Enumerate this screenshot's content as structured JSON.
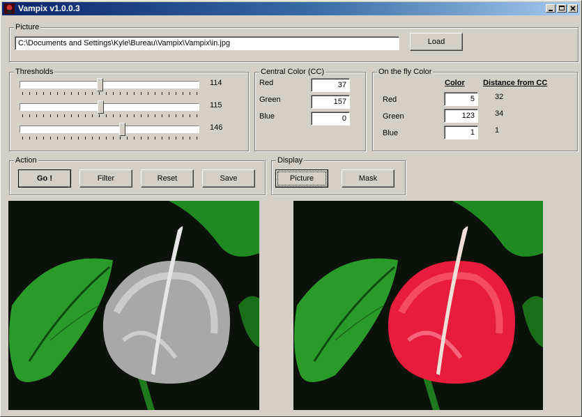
{
  "window": {
    "title": "Vampix v1.0.0.3",
    "min_label": "_",
    "max_label": "□",
    "close_label": "×"
  },
  "picture": {
    "label": "Picture",
    "path": "C:\\Documents and Settings\\Kyle\\Bureau\\Vampix\\Vampix\\in.jpg",
    "load_label": "Load"
  },
  "thresholds": {
    "label": "Thresholds",
    "items": [
      {
        "value": "114",
        "level": 114
      },
      {
        "value": "115",
        "level": 115
      },
      {
        "value": "146",
        "level": 146
      }
    ],
    "max": 255
  },
  "central": {
    "label": "Central Color (CC)",
    "red_label": "Red",
    "green_label": "Green",
    "blue_label": "Blue",
    "red": "37",
    "green": "157",
    "blue": "0"
  },
  "onthefly": {
    "label": "On the fly Color",
    "color_header": "Color",
    "distance_header": "Distance from CC",
    "red_label": "Red",
    "green_label": "Green",
    "blue_label": "Blue",
    "red": "5",
    "green": "123",
    "blue": "1",
    "dist_red": "32",
    "dist_green": "34",
    "dist_blue": "1"
  },
  "action": {
    "label": "Action",
    "go": "Go !",
    "filter": "Filter",
    "reset": "Reset",
    "save": "Save"
  },
  "display": {
    "label": "Display",
    "picture": "Picture",
    "mask": "Mask"
  },
  "colors": {
    "titlebar_start": "#0a246a",
    "flower_gray": "#c8c8c8",
    "flower_red": "#e81c3c",
    "leaf_green": "#2a9a2a"
  }
}
